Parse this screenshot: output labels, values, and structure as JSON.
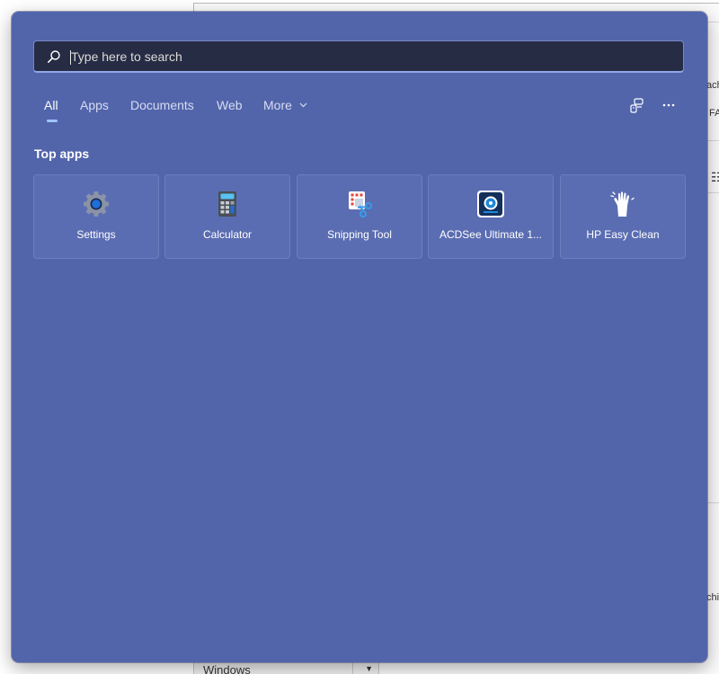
{
  "search": {
    "placeholder": "Type here to search",
    "value": ""
  },
  "tabs": [
    {
      "label": "All",
      "active": true
    },
    {
      "label": "Apps"
    },
    {
      "label": "Documents"
    },
    {
      "label": "Web"
    },
    {
      "label": "More"
    }
  ],
  "toolbar": {
    "connect_icon": "devices-icon",
    "more_icon": "ellipsis-icon"
  },
  "top_apps": {
    "title": "Top apps",
    "items": [
      {
        "label": "Settings",
        "icon": "settings-gear-icon"
      },
      {
        "label": "Calculator",
        "icon": "calculator-icon"
      },
      {
        "label": "Snipping Tool",
        "icon": "snipping-tool-icon"
      },
      {
        "label": "ACDSee Ultimate 1...",
        "icon": "acdsee-icon"
      },
      {
        "label": "HP Easy Clean",
        "icon": "hp-easy-clean-icon"
      }
    ]
  },
  "background": {
    "fragments": [
      "ach",
      "FA",
      "chi"
    ],
    "dropdown_value": "Windows"
  },
  "colors": {
    "flyout_bg": "#5265ab",
    "search_bg": "#262c43",
    "tab_underline": "#9fc3ff",
    "tile_bg": "#5b6db2"
  }
}
